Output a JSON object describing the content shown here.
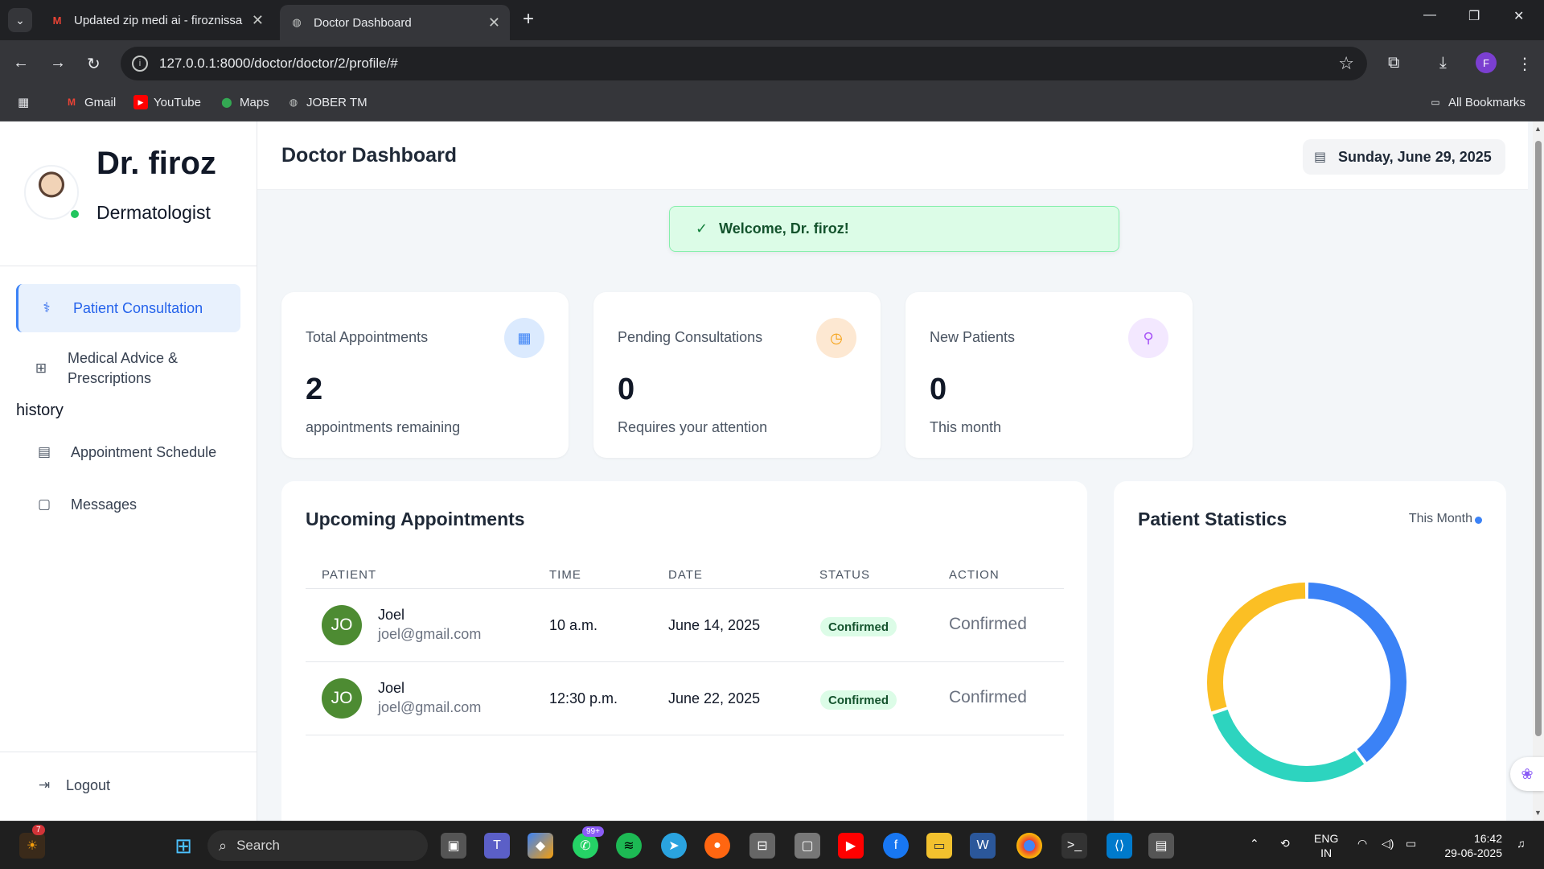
{
  "browser": {
    "tabs": [
      {
        "title": "Updated zip medi ai - firoznissa"
      },
      {
        "title": "Doctor Dashboard"
      }
    ],
    "url": "127.0.0.1:8000/doctor/doctor/2/profile/#",
    "bookmarks": [
      "Gmail",
      "YouTube",
      "Maps",
      "JOBER TM"
    ],
    "all_bookmarks": "All Bookmarks",
    "profile_initial": "F"
  },
  "sidebar": {
    "doctor_name": "Dr. firoz",
    "specialty": "Dermatologist",
    "nav": [
      {
        "label": "Patient Consultation",
        "icon": "stethoscope-icon"
      },
      {
        "label": "Medical Advice & Prescriptions",
        "icon": "medical-kit-icon"
      },
      {
        "label": "Appointment Schedule",
        "icon": "calendar-icon"
      },
      {
        "label": "Messages",
        "icon": "chat-icon"
      }
    ],
    "stray_text": "history",
    "logout": "Logout"
  },
  "header": {
    "title": "Doctor Dashboard",
    "date": "Sunday, June 29, 2025"
  },
  "alert": {
    "message": "Welcome, Dr. firoz!"
  },
  "cards": [
    {
      "label": "Total Appointments",
      "value": "2",
      "sub": "appointments remaining",
      "icon": "calendar-check-icon",
      "color": "#3b82f6"
    },
    {
      "label": "Pending Consultations",
      "value": "0",
      "sub": "Requires your attention",
      "icon": "clock-icon",
      "color": "#f59e0b"
    },
    {
      "label": "New Patients",
      "value": "0",
      "sub": "This month",
      "icon": "user-plus-icon",
      "color": "#a855f7"
    }
  ],
  "appointments": {
    "title": "Upcoming Appointments",
    "columns": [
      "PATIENT",
      "TIME",
      "DATE",
      "STATUS",
      "ACTION"
    ],
    "rows": [
      {
        "initials": "JO",
        "name": "Joel",
        "email": "joel@gmail.com",
        "time": "10 a.m.",
        "date": "June 14, 2025",
        "status": "Confirmed",
        "action": "Confirmed"
      },
      {
        "initials": "JO",
        "name": "Joel",
        "email": "joel@gmail.com",
        "time": "12:30 p.m.",
        "date": "June 22, 2025",
        "status": "Confirmed",
        "action": "Confirmed"
      }
    ]
  },
  "stats": {
    "title": "Patient Statistics",
    "period": "This Month",
    "segments": [
      {
        "color": "#3b82f6",
        "fraction": 0.4
      },
      {
        "color": "#2dd4bf",
        "fraction": 0.3
      },
      {
        "color": "#fbbf24",
        "fraction": 0.3
      }
    ]
  },
  "taskbar": {
    "search_placeholder": "Search",
    "whatsapp_badge": "99+",
    "widget_badge": "7",
    "language": "ENG",
    "region": "IN",
    "time": "16:42",
    "date": "29-06-2025"
  }
}
